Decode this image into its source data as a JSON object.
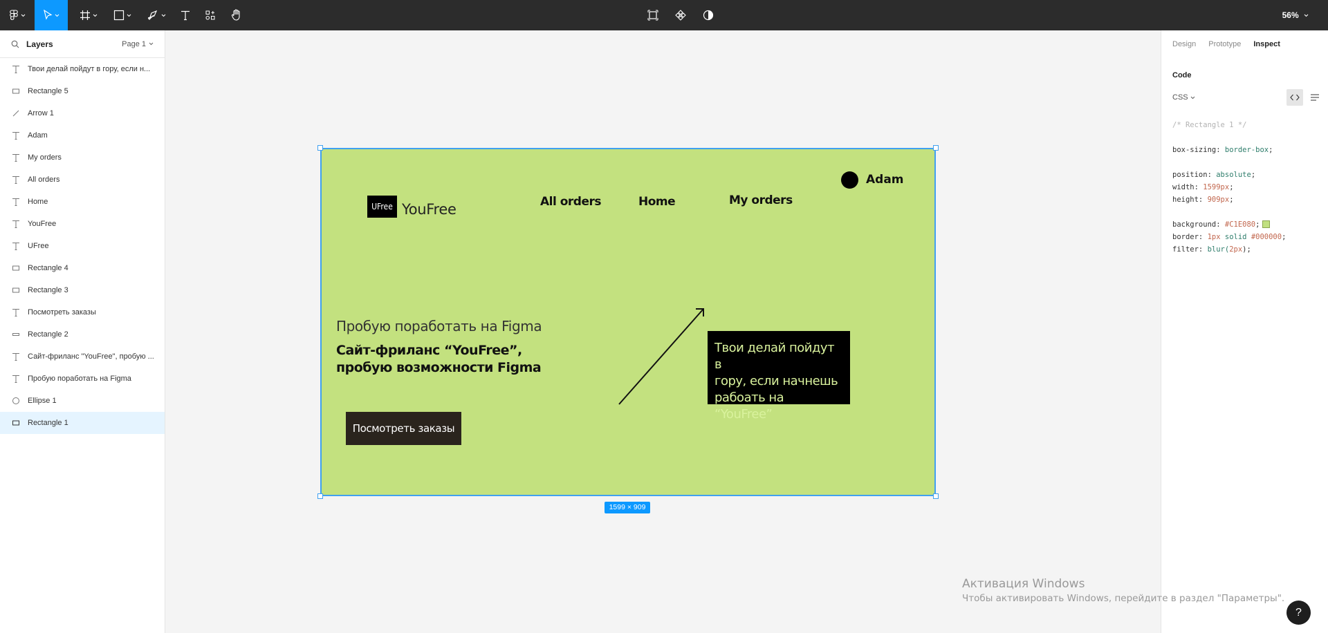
{
  "toolbar": {
    "zoom": "56%",
    "icons": [
      "figma-menu-icon",
      "move-tool-icon",
      "frame-tool-icon",
      "shape-tool-icon",
      "pen-tool-icon",
      "text-tool-icon",
      "resources-icon",
      "hand-tool-icon",
      "select-frame-icon",
      "components-icon",
      "contrast-icon"
    ]
  },
  "layers_panel": {
    "title": "Layers",
    "page": "Page 1",
    "items": [
      {
        "type": "text",
        "name": "Твои делай пойдут в гору, если н..."
      },
      {
        "type": "rect",
        "name": "Rectangle 5"
      },
      {
        "type": "arrow",
        "name": "Arrow 1"
      },
      {
        "type": "text",
        "name": "Adam"
      },
      {
        "type": "text",
        "name": "My orders"
      },
      {
        "type": "text",
        "name": "All orders"
      },
      {
        "type": "text",
        "name": "Home"
      },
      {
        "type": "text",
        "name": "YouFree"
      },
      {
        "type": "text",
        "name": "UFree"
      },
      {
        "type": "rect",
        "name": "Rectangle 4"
      },
      {
        "type": "rect",
        "name": "Rectangle 3"
      },
      {
        "type": "text",
        "name": "Посмотреть заказы"
      },
      {
        "type": "rect-thin",
        "name": "Rectangle 2"
      },
      {
        "type": "text",
        "name": "Сайт-фриланс \"YouFree\", пробую ..."
      },
      {
        "type": "text",
        "name": "Пробую поработать на Figma"
      },
      {
        "type": "ellipse",
        "name": "Ellipse 1"
      },
      {
        "type": "rect-selected",
        "name": "Rectangle 1"
      }
    ]
  },
  "inspect_panel": {
    "tabs": [
      "Design",
      "Prototype",
      "Inspect"
    ],
    "active_tab": "Inspect",
    "code_title": "Code",
    "language": "CSS",
    "comment": "/* Rectangle 1 */",
    "props": {
      "box_sizing_key": "box-sizing:",
      "box_sizing_val": "border-box",
      "position_key": "position:",
      "position_val": "absolute",
      "width_key": "width:",
      "width_val": "1599px",
      "height_key": "height:",
      "height_val": "909px",
      "background_key": "background:",
      "background_val": "#C1E080",
      "border_key": "border:",
      "border_val_1": "1px",
      "border_val_2": "solid",
      "border_val_3": "#000000",
      "filter_key": "filter:",
      "filter_fn": "blur(",
      "filter_val": "2px",
      "filter_close": ");"
    },
    "swatch_color": "#C1E080"
  },
  "canvas": {
    "frame_size_label": "1599 × 909",
    "frame_color": "#C3E17F",
    "logo_badge": "UFree",
    "logo_text": "YouFree",
    "nav": {
      "all_orders": "All orders",
      "home": "Home",
      "my_orders": "My orders"
    },
    "user_name": "Adam",
    "subtitle": "Пробую поработать на Figma",
    "headline_line1": "Сайт-фриланс “YouFree”,",
    "headline_line2": "пробую возможности Figma",
    "cta_label": "Посмотреть заказы",
    "promo_line1": "Твои делай пойдут в",
    "promo_line2": "гору, если начнешь",
    "promo_line3": "рабоать на “YouFree”"
  },
  "windows_activation": {
    "title": "Активация Windows",
    "subtitle": "Чтобы активировать Windows, перейдите в раздел \"Параметры\"."
  },
  "help_label": "?"
}
